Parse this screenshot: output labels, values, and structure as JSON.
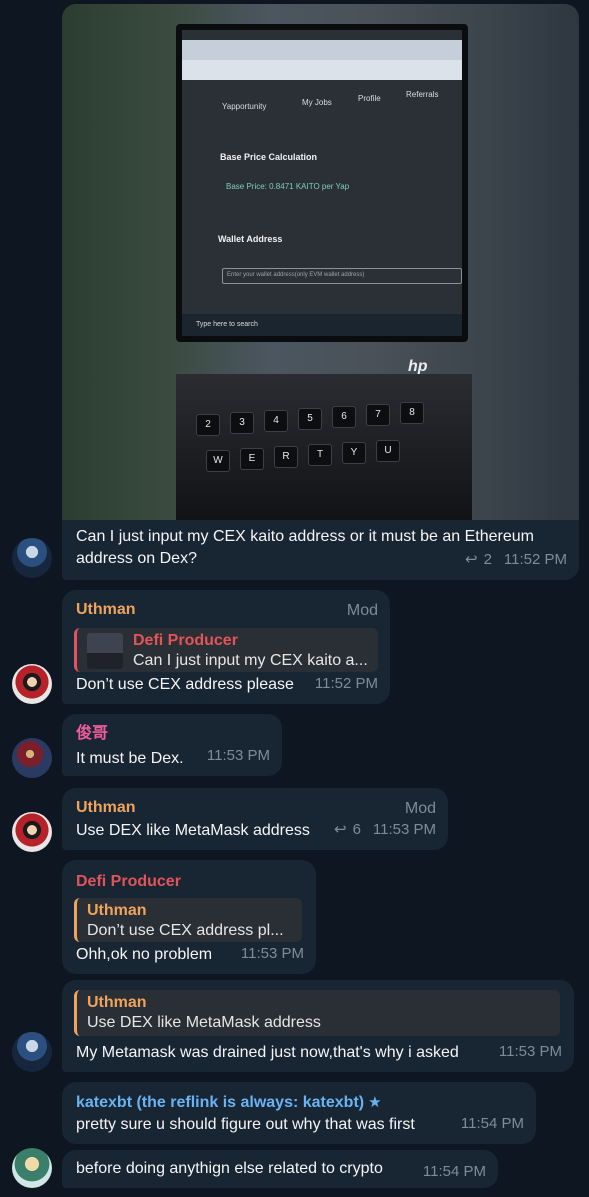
{
  "messages": [
    {
      "text": "Can I just input my CEX kaito address or it must be an Ethereum address on Dex?",
      "replies": "2",
      "time": "11:52 PM",
      "photo": {
        "screen_nav": [
          "Yapportunity",
          "My Jobs",
          "Profile",
          "Referrals"
        ],
        "screen_heading": "Base Price Calculation",
        "screen_base_price": "Base Price: 0.8471 KAITO per Yap",
        "screen_wallet_label": "Wallet Address",
        "screen_input_placeholder": "Enter your wallet address(only EVM wallet address)",
        "taskbar_search": "Type here to search",
        "laptop_logo": "hp"
      }
    },
    {
      "name": "Uthman",
      "role": "Mod",
      "quote_name": "Defi Producer",
      "quote_text": "Can I just input my CEX kaito a...",
      "text": "Don’t use CEX address please",
      "time": "11:52 PM"
    },
    {
      "name": "俊哥",
      "text": "It must be Dex.",
      "time": "11:53 PM"
    },
    {
      "name": "Uthman",
      "role": "Mod",
      "text": "Use DEX like MetaMask address",
      "replies": "6",
      "time": "11:53 PM"
    },
    {
      "name": "Defi Producer",
      "quote_name": "Uthman",
      "quote_text": "Don’t use CEX address pl...",
      "text": "Ohh,ok no problem",
      "time": "11:53 PM"
    },
    {
      "quote_name": "Uthman",
      "quote_text": "Use DEX like MetaMask address",
      "text": "My Metamask was drained just now,that's why i asked",
      "time": "11:53 PM"
    },
    {
      "name": "katexbt (the reflink is always: katexbt)",
      "text": "pretty sure u should figure out why that was first",
      "time": "11:54 PM"
    },
    {
      "text": "before doing anythign else related to crypto",
      "time": "11:54 PM"
    }
  ],
  "icons": {
    "reply": "reply-arrow-icon",
    "star": "premium-star-icon"
  },
  "colors": {
    "background": "#0e1621",
    "bubble": "#182533",
    "name_orange": "#f0a35d",
    "name_red": "#e1545a",
    "name_pink": "#ee5d9b",
    "name_blue": "#6ab3f3"
  }
}
